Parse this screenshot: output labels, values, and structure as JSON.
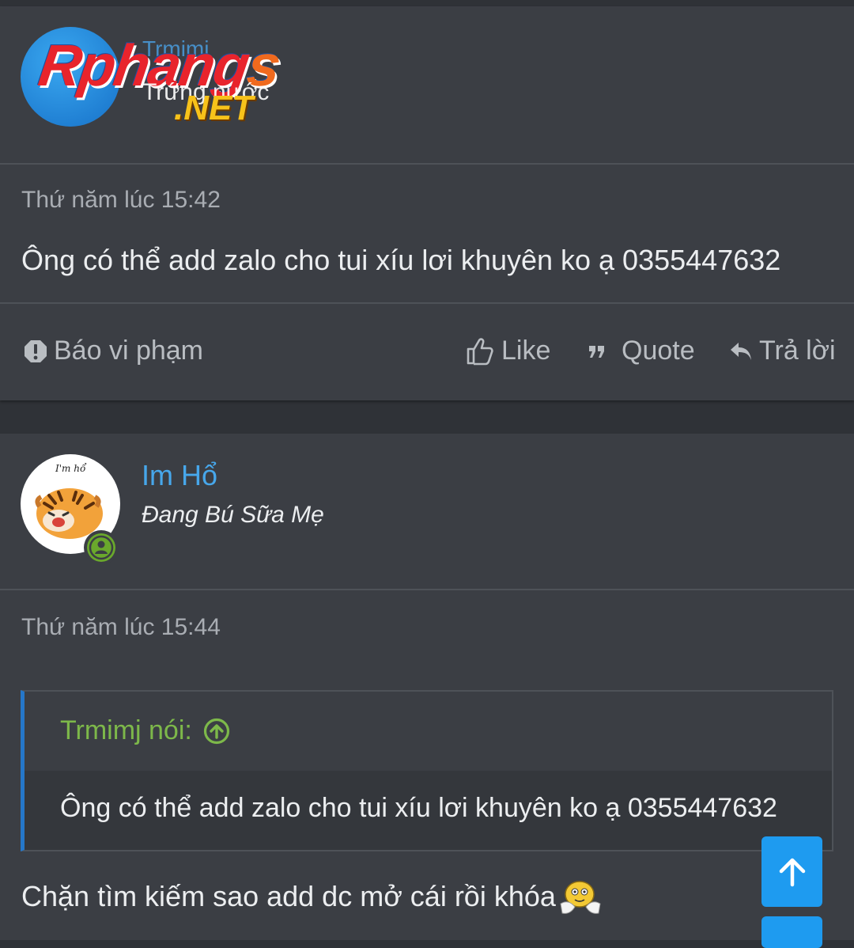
{
  "post1": {
    "logo": {
      "word": "Rphang",
      "word_tail": "s",
      "suffix": ".NET",
      "overlay_user": "Trmimj",
      "overlay_title": "Trứng nước"
    },
    "time": "Thứ năm lúc 15:42",
    "content": "Ông có thể add zalo cho tui xíu lơi khuyên ko ạ 0355447632",
    "actions": {
      "report": "Báo vi phạm",
      "like": "Like",
      "quote": "Quote",
      "reply": "Trả lời"
    }
  },
  "post2": {
    "username": "Im Hổ",
    "user_title": "Đang Bú Sữa Mẹ",
    "avatar_text": "I'm hổ",
    "time": "Thứ năm lúc 15:44",
    "quote": {
      "author": "Trmimj nói:",
      "text": "Ông có thể add zalo cho tui xíu lơi khuyên ko ạ 0355447632"
    },
    "content": "Chặn tìm kiếm sao add dc mở cái rồi khóa"
  },
  "colors": {
    "accent": "#47a7eb",
    "quote_author": "#7db84a",
    "scroll_button": "#1e9bf0",
    "online": "#6aa82c"
  }
}
